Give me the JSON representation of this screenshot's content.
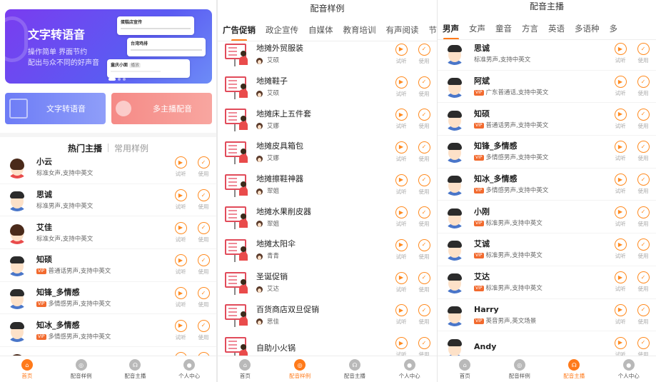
{
  "home": {
    "banner": {
      "title": "文字转语音",
      "line1": "操作简单 界面节约",
      "line2": "配出与众不同的好声音",
      "cards": [
        {
          "title": "蛋糕店宣传",
          "badge": ""
        },
        {
          "title": "台湾鸡排",
          "badge": ""
        },
        {
          "title": "童庆小面",
          "badge": "播放"
        }
      ]
    },
    "quick": [
      {
        "label": "文字转语音"
      },
      {
        "label": "多主播配音"
      }
    ],
    "segment": {
      "active": "热门主播",
      "other": "常用样例"
    },
    "items": [
      {
        "name": "小云",
        "desc": "标准女声,支持中英文",
        "vip": false,
        "gender": "f"
      },
      {
        "name": "思诚",
        "desc": "标准男声,支持中英文",
        "vip": false,
        "gender": "m"
      },
      {
        "name": "艾佳",
        "desc": "标准女声,支持中英文",
        "vip": false,
        "gender": "f"
      },
      {
        "name": "知硕",
        "desc": "普通话男声,支持中英文",
        "vip": true,
        "gender": "m"
      },
      {
        "name": "知锋_多情感",
        "desc": "多情感男声,支持中英文",
        "vip": true,
        "gender": "m"
      },
      {
        "name": "知冰_多情感",
        "desc": "多情感男声,支持中英文",
        "vip": true,
        "gender": "m"
      },
      {
        "name": "知妙_多情感",
        "desc": "",
        "vip": false,
        "gender": "f"
      }
    ]
  },
  "samples": {
    "title": "配音样例",
    "tabs": [
      "广告促销",
      "政企宣传",
      "自媒体",
      "教育培训",
      "有声阅读",
      "节"
    ],
    "active_tab": 0,
    "items": [
      {
        "name": "地摊外贸服装",
        "voice": "艾硕"
      },
      {
        "name": "地摊鞋子",
        "voice": "艾硕"
      },
      {
        "name": "地摊床上五件套",
        "voice": "艾娜"
      },
      {
        "name": "地摊皮具箱包",
        "voice": "艾娜"
      },
      {
        "name": "地摊擦鞋神器",
        "voice": "翠姐"
      },
      {
        "name": "地摊水果削皮器",
        "voice": "翠姐"
      },
      {
        "name": "地摊太阳伞",
        "voice": "青青"
      },
      {
        "name": "圣诞促销",
        "voice": "艾达"
      },
      {
        "name": "百货商店双旦促销",
        "voice": "思佳"
      },
      {
        "name": "自助小火锅",
        "voice": ""
      }
    ]
  },
  "anchors": {
    "title": "配音主播",
    "tabs": [
      "男声",
      "女声",
      "童音",
      "方言",
      "英语",
      "多语种",
      "多"
    ],
    "active_tab": 0,
    "items": [
      {
        "name": "思诚",
        "desc": "标准男声,支持中英文",
        "vip": false
      },
      {
        "name": "阿斌",
        "desc": "广东普通话,支持中英文",
        "vip": true
      },
      {
        "name": "知硕",
        "desc": "普通话男声,支持中英文",
        "vip": true
      },
      {
        "name": "知锋_多情感",
        "desc": "多情感男声,支持中英文",
        "vip": true
      },
      {
        "name": "知冰_多情感",
        "desc": "多情感男声,支持中英文",
        "vip": true
      },
      {
        "name": "小刚",
        "desc": "标准男声,支持中英文",
        "vip": true
      },
      {
        "name": "艾诚",
        "desc": "标准男声,支持中英文",
        "vip": true
      },
      {
        "name": "艾达",
        "desc": "标准男声,支持中英文",
        "vip": true
      },
      {
        "name": "Harry",
        "desc": "英音男声,英文场景",
        "vip": true
      },
      {
        "name": "Andy",
        "desc": "",
        "vip": false
      }
    ]
  },
  "common": {
    "vip": "VIP",
    "listen": "试听",
    "use": "使用",
    "play_glyph": "▶",
    "check_glyph": "✓"
  },
  "nav": [
    {
      "label": "首页",
      "icon": "home-icon"
    },
    {
      "label": "配音样例",
      "icon": "waveform-icon"
    },
    {
      "label": "配音主播",
      "icon": "anchor-icon"
    },
    {
      "label": "个人中心",
      "icon": "user-icon"
    }
  ],
  "colors": {
    "accent": "#ff7a1a",
    "banner": "#6a4cf2",
    "vip": "#f26a2e"
  }
}
